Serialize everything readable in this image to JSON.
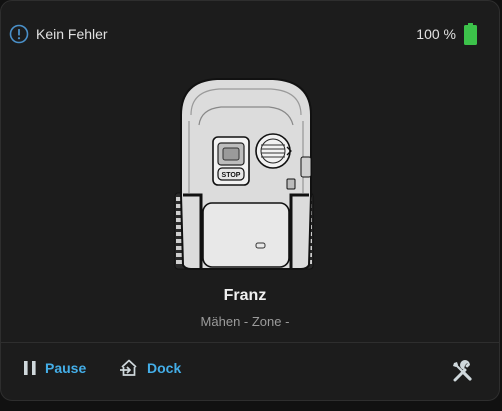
{
  "status": {
    "text": "Kein Fehler",
    "icon": "info-circle-icon",
    "icon_color": "#4a90c9"
  },
  "battery": {
    "level_text": "100 %",
    "level_percent": 100,
    "icon": "battery-full-icon",
    "color": "#3cc24a"
  },
  "mower": {
    "image": "robotic-mower-illustration",
    "stop_label": "STOP",
    "name": "Franz",
    "activity": "Mähen",
    "separator": " - ",
    "zone_label": "Zone",
    "zone_suffix": " -"
  },
  "actions": {
    "pause_label": "Pause",
    "dock_label": "Dock",
    "tools_icon": "tools-icon",
    "accent": "#44aee8"
  }
}
